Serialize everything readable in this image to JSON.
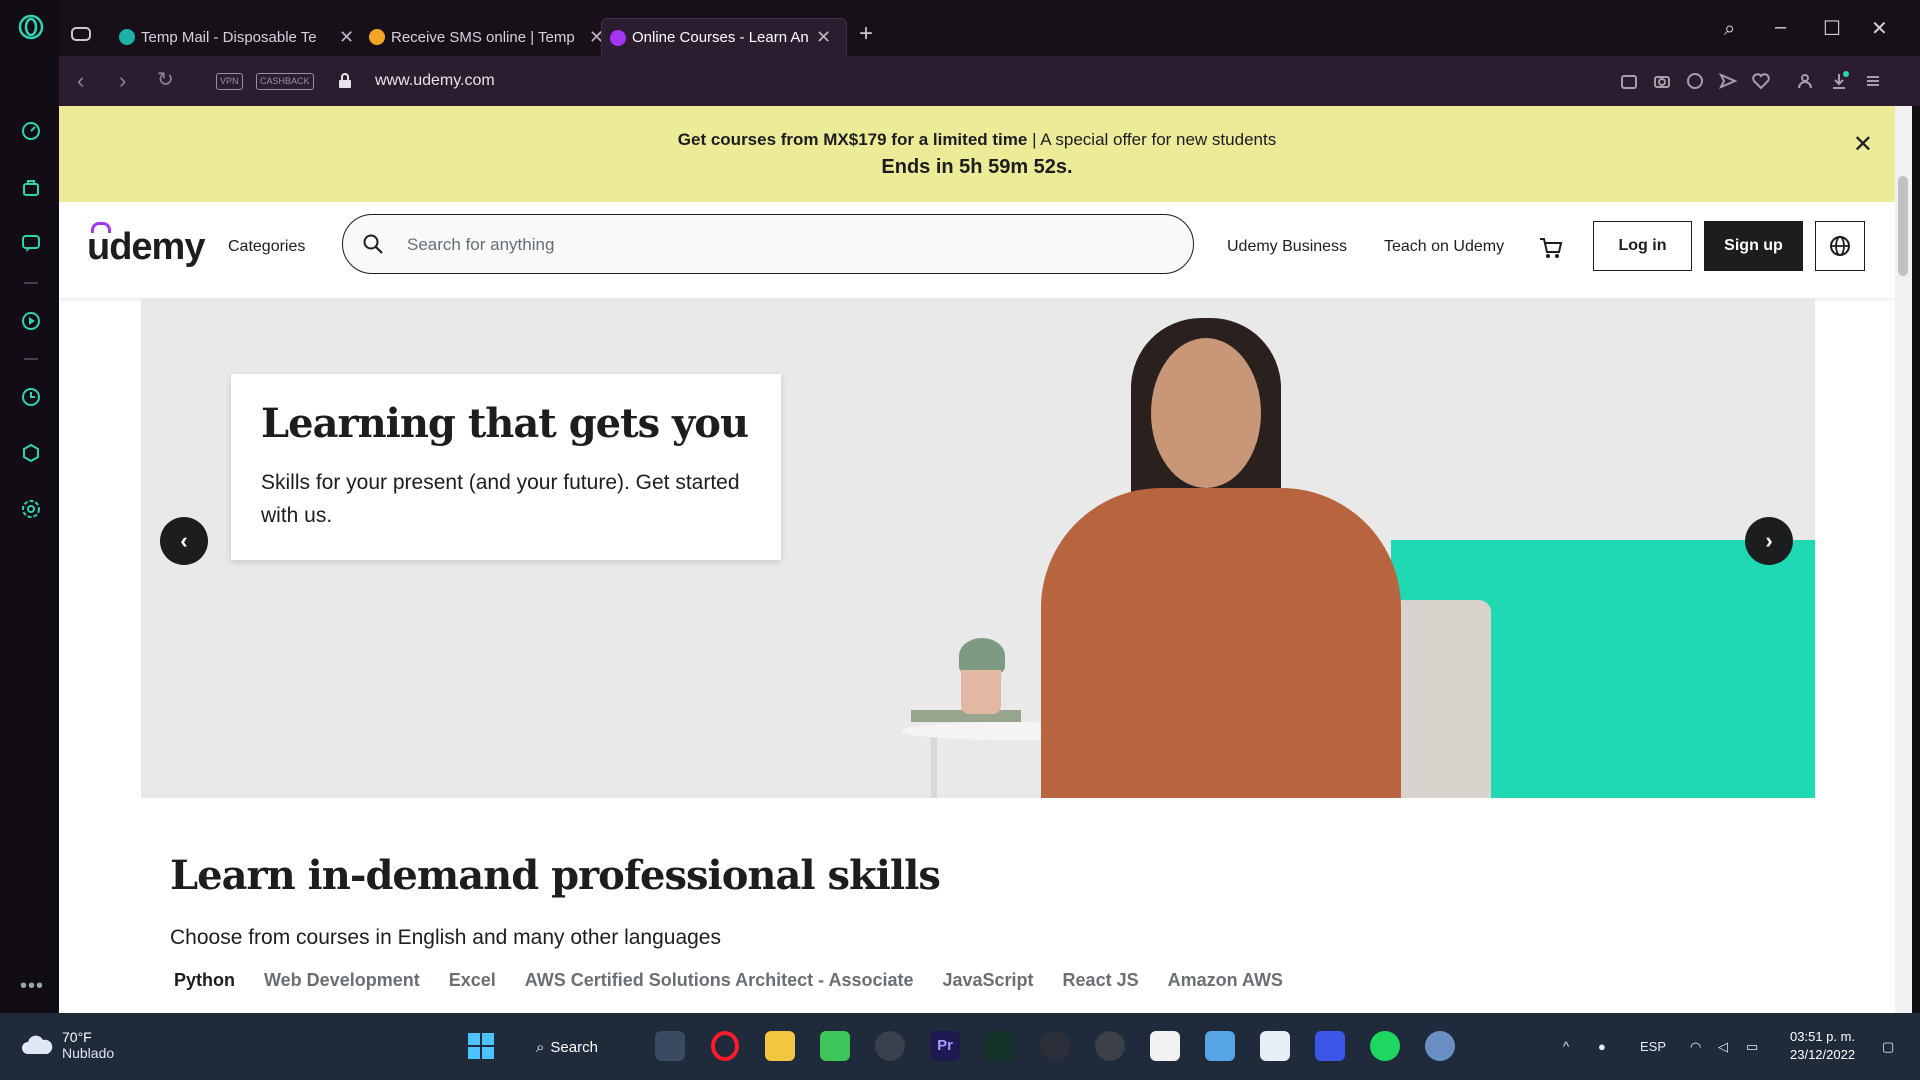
{
  "browser": {
    "tabs": [
      {
        "title": "Temp Mail - Disposable Te",
        "favicon_color": "#1bb3a7"
      },
      {
        "title": "Receive SMS online | Temp",
        "favicon_color": "#f5a623"
      },
      {
        "title": "Online Courses - Learn An",
        "favicon_color": "#a435f0"
      }
    ],
    "new_tab": "+",
    "url": "www.udemy.com",
    "pill_vpn": "VPN",
    "pill_cashback": "CASHBACK"
  },
  "banner": {
    "bold_text": "Get courses from MX$179 for a limited time",
    "rest_text": " | A special offer for new students",
    "countdown": "Ends in 5h 59m 52s.",
    "close": "✕"
  },
  "header": {
    "logo": "udemy",
    "categories": "Categories",
    "search_placeholder": "Search for anything",
    "business_link": "Udemy Business",
    "teach_link": "Teach on Udemy",
    "login": "Log in",
    "signup": "Sign up"
  },
  "hero": {
    "title": "Learning that gets you",
    "subtitle": "Skills for your present (and your future). Get started with us.",
    "prev": "‹",
    "next": "›"
  },
  "skills": {
    "title": "Learn in-demand professional skills",
    "subtitle": "Choose from courses in English and many other languages",
    "tabs": [
      "Python",
      "Web Development",
      "Excel",
      "AWS Certified Solutions Architect - Associate",
      "JavaScript",
      "React JS",
      "Amazon AWS"
    ]
  },
  "taskbar": {
    "temperature": "70°F",
    "condition": "Nublado",
    "search": "Search",
    "language": "ESP",
    "time": "03:51 p. m.",
    "date": "23/12/2022"
  },
  "colors": {
    "brand": "#a435f0",
    "banner": "#eceb98",
    "teal": "#1ed9b2"
  }
}
